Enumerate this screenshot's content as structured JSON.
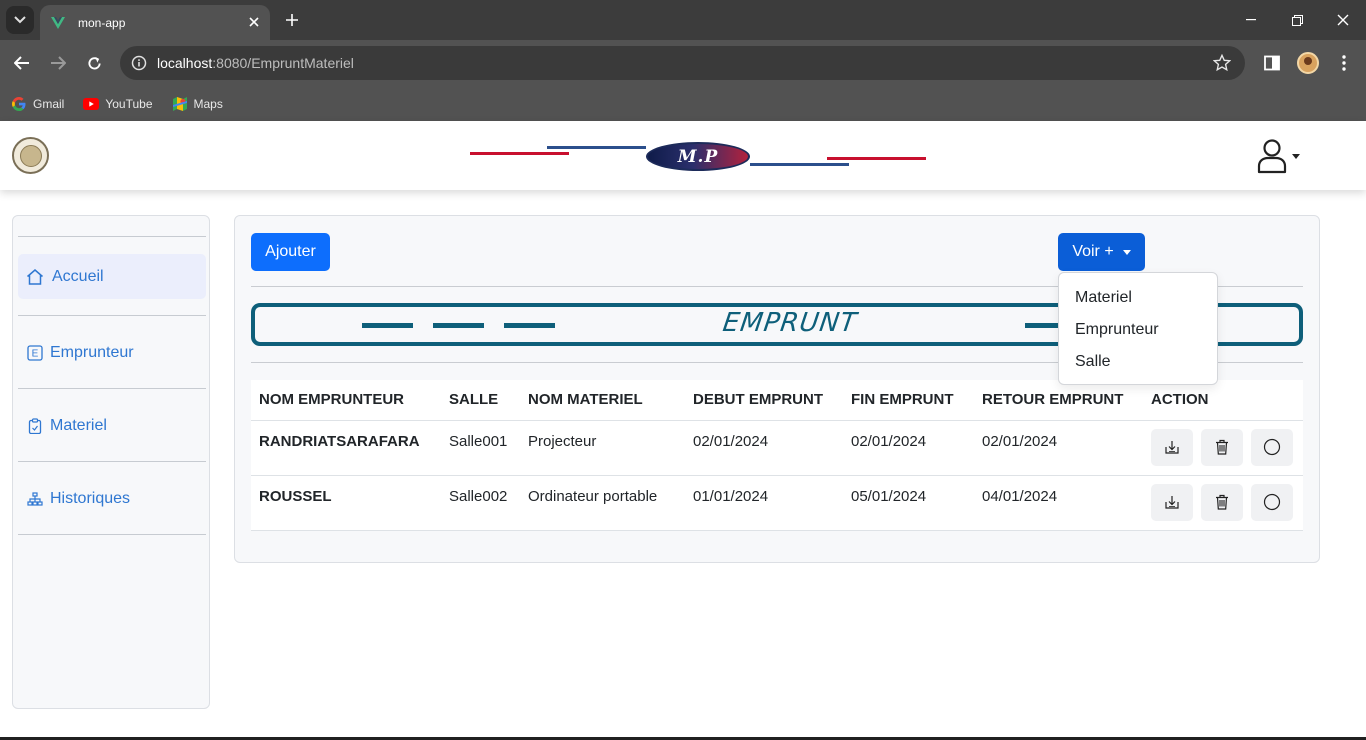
{
  "browser": {
    "tab_title": "mon-app",
    "url_host": "localhost",
    "url_rest": ":8080/EmpruntMateriel",
    "bookmarks": [
      {
        "label": "Gmail",
        "icon": "google-icon"
      },
      {
        "label": "YouTube",
        "icon": "youtube-icon"
      },
      {
        "label": "Maps",
        "icon": "maps-icon"
      }
    ]
  },
  "header": {
    "brand": "M.P",
    "colors": {
      "red": "#c8102e",
      "blue": "#2b4f8c"
    }
  },
  "sidebar": {
    "items": [
      {
        "label": "Accueil",
        "icon": "home-icon",
        "active": true
      },
      {
        "label": "Emprunteur",
        "icon": "e-badge-icon"
      },
      {
        "label": "Materiel",
        "icon": "clipboard-icon"
      },
      {
        "label": "Historiques",
        "icon": "sitemap-icon"
      }
    ]
  },
  "main": {
    "add_label": "Ajouter",
    "voir_label": "Voir +",
    "banner_title": "EMPRUNT",
    "dropdown": [
      "Materiel",
      "Emprunteur",
      "Salle"
    ],
    "table": {
      "headers": [
        "NOM EMPRUNTEUR",
        "SALLE",
        "NOM MATERIEL",
        "DEBUT EMPRUNT",
        "FIN EMPRUNT",
        "RETOUR EMPRUNT",
        "ACTION"
      ],
      "rows": [
        [
          "RANDRIATSARAFARA",
          "Salle001",
          "Projecteur",
          "02/01/2024",
          "02/01/2024",
          "02/01/2024"
        ],
        [
          "ROUSSEL",
          "Salle002",
          "Ordinateur portable",
          "01/01/2024",
          "05/01/2024",
          "04/01/2024"
        ]
      ]
    },
    "accent": "#0d6efd",
    "banner_color": "#0e5f7a"
  }
}
